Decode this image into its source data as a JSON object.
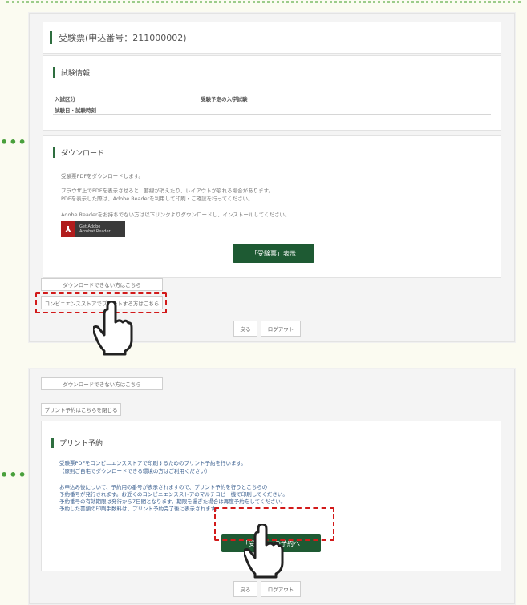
{
  "screen1": {
    "title": "受験票(申込番号：211000002)",
    "exam_info": {
      "heading": "試験情報",
      "col1_label": "入試区分",
      "col2_label": "受験予定の入学試験",
      "row_label": "試験日・試験時刻"
    },
    "download": {
      "heading": "ダウンロード",
      "line1": "受験票PDFをダウンロードします。",
      "line2": "ブラウザ上でPDFを表示させると、罫線が消えたり、レイアウトが崩れる場合があります。",
      "line3": "PDFを表示した際は、Adobe Readerを利用して印刷・ご確認を行ってください。",
      "line4": "Adobe Readerをお持ちでない方は以下リンクよりダウンロードし、インストールしてください。",
      "adobe_line1": "Get Adobe",
      "adobe_line2": "Acrobat Reader",
      "show_button": "「受験票」表示"
    },
    "link1": "ダウンロードできない方はこちら",
    "link2": "コンビニエンスストアでプリントする方はこちら",
    "back_button": "戻る",
    "logout_button": "ログアウト"
  },
  "screen2": {
    "link1": "ダウンロードできない方はこちら",
    "link2": "プリント予約はこちらを閉じる",
    "print": {
      "heading": "プリント予約",
      "line1": "受験票PDFをコンビニエンスストアで印刷するためのプリント予約を行います。",
      "line2": "（原則ご自宅でダウンロードできる環境の方はご利用ください）",
      "line3": "お申込み後について、予約用の番号が表示されますので、プリント予約を行うとこちらの",
      "line4": "予約番号が発行されます。お近くのコンビニエンスストアのマルチコピー機で印刷してください。",
      "line5": "予約番号の有効期限は発行から7日間となります。期限を過ぎた場合は再度予約をしてください。",
      "line6": "予約した書類の印刷手数料は、プリント予約完了後に表示されます。",
      "reserve_button": "「受験票」の予約へ"
    },
    "back_button": "戻る",
    "logout_button": "ログアウト"
  },
  "colors": {
    "green": "#1e5a33",
    "accent_dots": "#49a03c",
    "highlight": "#d21a1a"
  },
  "icons": [
    "pointing-hand-icon",
    "adobe-reader-icon"
  ]
}
